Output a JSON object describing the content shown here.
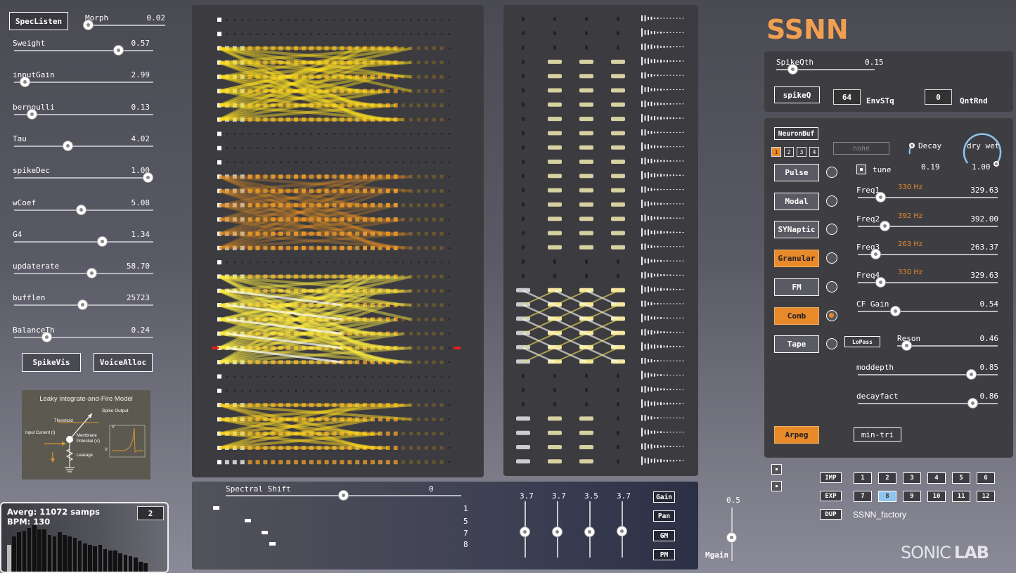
{
  "left": {
    "speclisten_label": "SpecListen",
    "morph": {
      "label": "Morph",
      "value": "0.02"
    },
    "sliders": [
      {
        "label": "Sweight",
        "value": "0.57",
        "pos": 0.78
      },
      {
        "label": "inputGain",
        "value": "2.99",
        "pos": 0.08
      },
      {
        "label": "bernoulli",
        "value": "0.13",
        "pos": 0.13
      },
      {
        "label": "Tau",
        "value": "4.02",
        "pos": 0.4
      },
      {
        "label": "spikeDec",
        "value": "1.00",
        "pos": 1.0
      },
      {
        "label": "wCoef",
        "value": "5.08",
        "pos": 0.5
      },
      {
        "label": "G4",
        "value": "1.34",
        "pos": 0.66
      },
      {
        "label": "updaterate",
        "value": "58.70",
        "pos": 0.58
      },
      {
        "label": "bufflen",
        "value": "25723",
        "pos": 0.51
      },
      {
        "label": "BalanceTh",
        "value": "0.24",
        "pos": 0.24
      }
    ],
    "spikevis_label": "SpikeVis",
    "voicealloc_label": "VoiceAlloc",
    "lif": {
      "title": "Leaky Integrate-and-Fire Model",
      "spike_output": "Spike Output",
      "threshold": "Threshold",
      "input_current": "Input Current (I)",
      "membrane": "Membrane",
      "potential": "Potential (V)",
      "leakage": "Leakage",
      "v": "V",
      "vreset": "V"
    },
    "stats": {
      "avg": "Averg: 11072 samps",
      "bpm": "BPM: 130",
      "box": "2"
    }
  },
  "bottom": {
    "spectral_shift_label": "Spectral Shift",
    "spectral_shift_value": "0",
    "steps": [
      "1",
      "5",
      "7",
      "8"
    ],
    "fader_values": [
      "3.7",
      "3.7",
      "3.5",
      "3.7"
    ],
    "buttons": [
      "Gain",
      "Pan",
      "GM",
      "PM"
    ],
    "mgain_label": "Mgain",
    "mgain_value": "0.5"
  },
  "right": {
    "title": "SSNN",
    "spikeqth": {
      "label": "SpikeQth",
      "value": "0.15"
    },
    "spikeq_label": "spikeQ",
    "envstq": {
      "value": "64",
      "label": "EnvSTq"
    },
    "qntrnd": {
      "value": "0",
      "label": "QntRnd"
    },
    "neuronbuf_label": "NeuronBuf",
    "buf_tabs": [
      "1",
      "2",
      "3",
      "4"
    ],
    "none_label": "none",
    "decay": {
      "label": "Decay",
      "value": "0.19"
    },
    "drywet": {
      "label": "dry wet",
      "value": "1.00"
    },
    "tune_label": "tune",
    "synths": [
      {
        "label": "Pulse",
        "active": false,
        "radio": false
      },
      {
        "label": "Modal",
        "active": false,
        "radio": false
      },
      {
        "label": "SYNaptic",
        "active": false,
        "radio": false
      },
      {
        "label": "Granular",
        "active": true,
        "radio": false
      },
      {
        "label": "FM",
        "active": false,
        "radio": false
      },
      {
        "label": "Comb",
        "active": true,
        "radio": true
      },
      {
        "label": "Tape",
        "active": false,
        "radio": false
      }
    ],
    "params": [
      {
        "label": "Freq1",
        "hz": "330 Hz",
        "value": "329.63",
        "pos": 0.17
      },
      {
        "label": "Freq2",
        "hz": "392 Hz",
        "value": "392.00",
        "pos": 0.2
      },
      {
        "label": "Freq3",
        "hz": "263 Hz",
        "value": "263.37",
        "pos": 0.13
      },
      {
        "label": "Freq4",
        "hz": "330 Hz",
        "value": "329.63",
        "pos": 0.17
      },
      {
        "label": "CF Gain",
        "hz": "",
        "value": "0.54",
        "pos": 0.28
      },
      {
        "label": "Reson",
        "hz": "",
        "value": "0.46",
        "pos": 0.1
      },
      {
        "label": "moddepth",
        "hz": "",
        "value": "0.85",
        "pos": 0.85
      },
      {
        "label": "decayfact",
        "hz": "",
        "value": "0.86",
        "pos": 0.86
      }
    ],
    "lopass_label": "LoPass",
    "arpeg_label": "Arpeg",
    "mintri_label": "min-tri",
    "imp_label": "IMP",
    "exp_label": "EXP",
    "dup_label": "DUP",
    "presets": [
      "1",
      "2",
      "3",
      "4",
      "5",
      "6",
      "7",
      "8",
      "9",
      "10",
      "11",
      "12"
    ],
    "selected_preset": "8",
    "preset_name": "SSNN_factory",
    "logo_a": "SONIC",
    "logo_b": "LAB"
  },
  "colors": {
    "accent": "#e8892a",
    "title": "#f0a050",
    "selected": "#8fc4ee"
  }
}
